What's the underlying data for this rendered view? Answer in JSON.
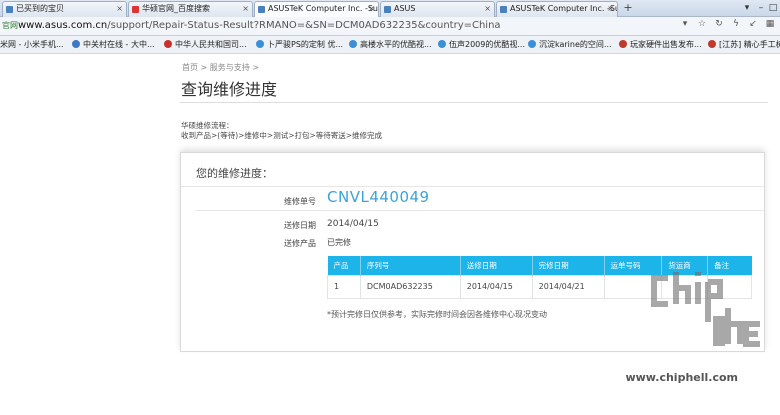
{
  "browser": {
    "tabs": [
      {
        "label": "已买到的宝贝",
        "active": false
      },
      {
        "label": "华硕官网_百度搜索",
        "active": false
      },
      {
        "label": "ASUSTeK Computer Inc. -Su",
        "active": true
      },
      {
        "label": "ASUS",
        "active": false
      },
      {
        "label": "ASUSTeK Computer Inc. -Su",
        "active": false
      }
    ],
    "new_tab": "+",
    "window_controls": [
      "▾",
      "–",
      "□"
    ],
    "address": {
      "prefix": "官网",
      "host": "www.asus.com.cn",
      "path": "/support/Repair-Status-Result?RMANO=&SN=DCM0AD632235&country=China"
    },
    "toolbar_icons": [
      "star-icon",
      "history-icon",
      "lightning-icon",
      "grid-icon"
    ],
    "bookmarks": [
      {
        "label": "米网 - 小米手机..."
      },
      {
        "label": "中关村在线 - 大中..."
      },
      {
        "label": "中华人民共和国司..."
      },
      {
        "label": "卜严骏PS的定制 优..."
      },
      {
        "label": "高楼水平的优酷视..."
      },
      {
        "label": "伍声2009的优酷视..."
      },
      {
        "label": "沉淀karine的空间..."
      },
      {
        "label": "玩家硬件出售发布..."
      },
      {
        "label": "[江苏] 精心手工树..."
      }
    ]
  },
  "page": {
    "breadcrumb": "首页 > 服务与支持 >",
    "title": "查询维修进度",
    "flow_label": "华硕维修流程：",
    "flow_steps": "收到产品>(等待)>维修中>测试>打包>等待寄送>维修完成",
    "card": {
      "heading": "您的维修进度：",
      "repair_no_label": "维修单号",
      "repair_no": "CNVL440049",
      "send_date_label": "送修日期",
      "send_date": "2014/04/15",
      "product_label": "送修产品",
      "product_status": "已完修",
      "table": {
        "headers": [
          "产品",
          "序列号",
          "送修日期",
          "完修日期",
          "运单号码",
          "货运商",
          "备注"
        ],
        "rows": [
          [
            "1",
            "DCM0AD632235",
            "2014/04/15",
            "2014/04/21",
            "",
            "",
            ""
          ]
        ]
      },
      "footnote": "*预计完修日仅供参考，实际完修时间会因各维修中心现况变动"
    }
  },
  "watermark": {
    "logo_text": "chip hell",
    "url": "www.chiphell.com"
  }
}
